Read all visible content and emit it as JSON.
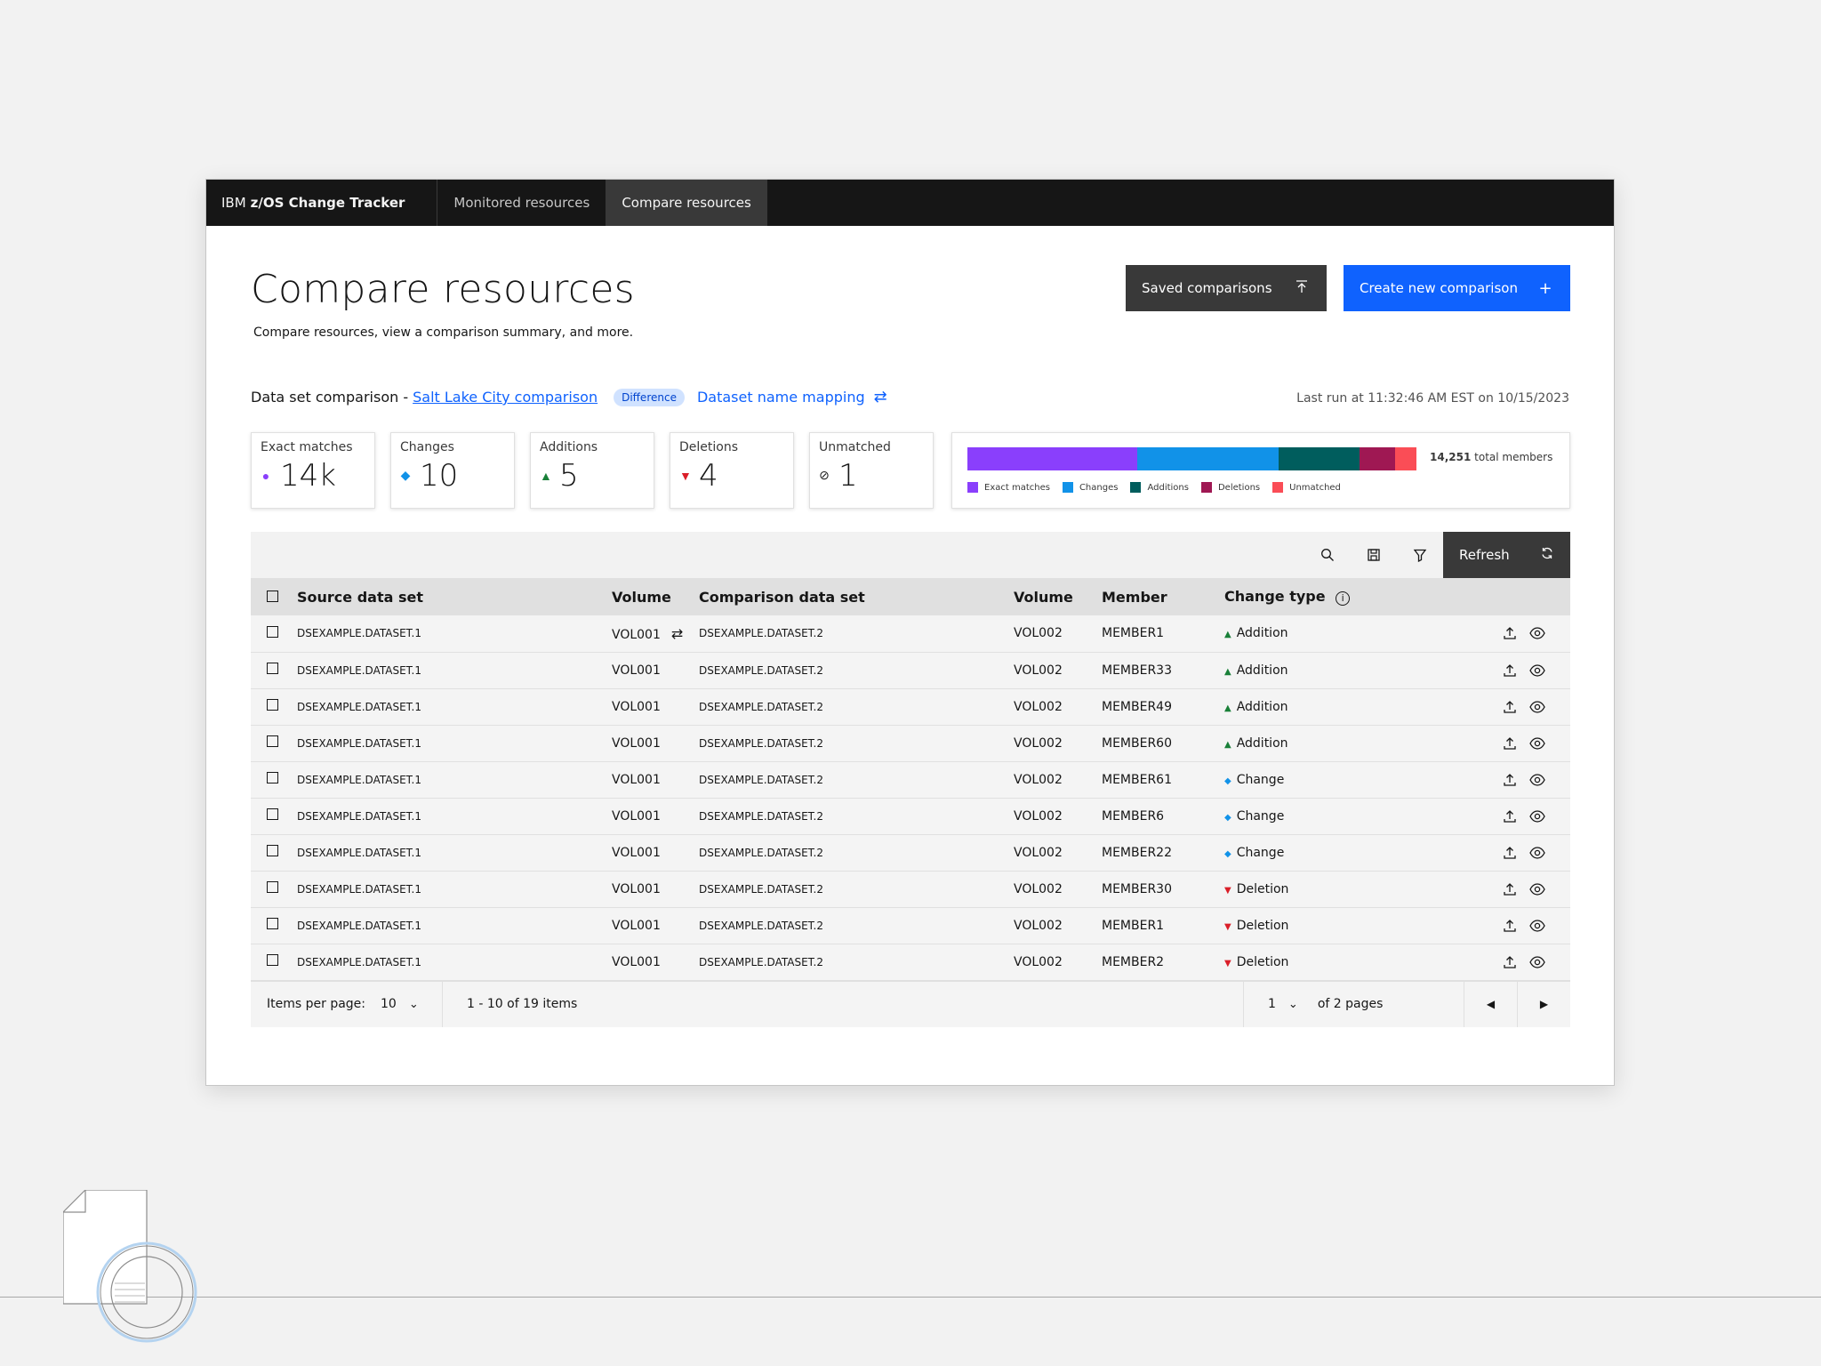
{
  "topbar": {
    "brand_prefix": "IBM",
    "brand_name": "z/OS Change Tracker",
    "tabs": [
      {
        "label": "Monitored resources"
      },
      {
        "label": "Compare resources"
      }
    ]
  },
  "page": {
    "title": "Compare resources",
    "subtitle": "Compare resources, view a comparison summary, and more."
  },
  "buttons": {
    "saved_label": "Saved comparisons",
    "saved_icon": "upload-icon",
    "create_label": "Create new comparison",
    "create_icon": "add-icon"
  },
  "context": {
    "prefix": "Data set comparison -",
    "comparison_link": "Salt Lake City comparison",
    "tag": "Difference",
    "mapping_link": "Dataset name mapping",
    "last_run": "Last run at 11:32:46 AM EST on 10/15/2023"
  },
  "cards": [
    {
      "label": "Exact matches",
      "value": "14k",
      "marker": "●",
      "color": "#8a3ffc"
    },
    {
      "label": "Changes",
      "value": "10",
      "marker": "◆",
      "color": "#1192e8"
    },
    {
      "label": "Additions",
      "value": "5",
      "marker": "▲",
      "color": "#198038"
    },
    {
      "label": "Deletions",
      "value": "4",
      "marker": "▼",
      "color": "#da1e28"
    },
    {
      "label": "Unmatched",
      "value": "1",
      "marker": "⊘",
      "color": "#161616"
    }
  ],
  "summary": {
    "total_value": "14,251",
    "total_suffix": "total members",
    "segments": [
      {
        "label": "Exact matches",
        "color": "#8a3ffc",
        "share": 0.378
      },
      {
        "label": "Changes",
        "color": "#1192e8",
        "share": 0.315
      },
      {
        "label": "Additions",
        "color": "#005d5d",
        "share": 0.18
      },
      {
        "label": "Deletions",
        "color": "#9f1853",
        "share": 0.08
      },
      {
        "label": "Unmatched",
        "color": "#fa4d56",
        "share": 0.047
      }
    ]
  },
  "toolbar": {
    "refresh_label": "Refresh"
  },
  "table": {
    "headers": [
      "Source data set",
      "Volume",
      "Comparison data set",
      "Volume",
      "Member",
      "Change type"
    ],
    "rows": [
      {
        "src": "DSEXAMPLE.DATASET.1",
        "vol1": "VOL001",
        "cmp": "DSEXAMPLE.DATASET.2",
        "vol2": "VOL002",
        "member": "MEMBER1",
        "type": "Addition"
      },
      {
        "src": "DSEXAMPLE.DATASET.1",
        "vol1": "VOL001",
        "cmp": "DSEXAMPLE.DATASET.2",
        "vol2": "VOL002",
        "member": "MEMBER33",
        "type": "Addition"
      },
      {
        "src": "DSEXAMPLE.DATASET.1",
        "vol1": "VOL001",
        "cmp": "DSEXAMPLE.DATASET.2",
        "vol2": "VOL002",
        "member": "MEMBER49",
        "type": "Addition"
      },
      {
        "src": "DSEXAMPLE.DATASET.1",
        "vol1": "VOL001",
        "cmp": "DSEXAMPLE.DATASET.2",
        "vol2": "VOL002",
        "member": "MEMBER60",
        "type": "Addition"
      },
      {
        "src": "DSEXAMPLE.DATASET.1",
        "vol1": "VOL001",
        "cmp": "DSEXAMPLE.DATASET.2",
        "vol2": "VOL002",
        "member": "MEMBER61",
        "type": "Change"
      },
      {
        "src": "DSEXAMPLE.DATASET.1",
        "vol1": "VOL001",
        "cmp": "DSEXAMPLE.DATASET.2",
        "vol2": "VOL002",
        "member": "MEMBER6",
        "type": "Change"
      },
      {
        "src": "DSEXAMPLE.DATASET.1",
        "vol1": "VOL001",
        "cmp": "DSEXAMPLE.DATASET.2",
        "vol2": "VOL002",
        "member": "MEMBER22",
        "type": "Change"
      },
      {
        "src": "DSEXAMPLE.DATASET.1",
        "vol1": "VOL001",
        "cmp": "DSEXAMPLE.DATASET.2",
        "vol2": "VOL002",
        "member": "MEMBER30",
        "type": "Deletion"
      },
      {
        "src": "DSEXAMPLE.DATASET.1",
        "vol1": "VOL001",
        "cmp": "DSEXAMPLE.DATASET.2",
        "vol2": "VOL002",
        "member": "MEMBER1",
        "type": "Deletion"
      },
      {
        "src": "DSEXAMPLE.DATASET.1",
        "vol1": "VOL001",
        "cmp": "DSEXAMPLE.DATASET.2",
        "vol2": "VOL002",
        "member": "MEMBER2",
        "type": "Deletion"
      }
    ]
  },
  "change_markers": {
    "Addition": {
      "glyph": "▲",
      "color": "#198038"
    },
    "Change": {
      "glyph": "◆",
      "color": "#1192e8"
    },
    "Deletion": {
      "glyph": "▼",
      "color": "#da1e28"
    }
  },
  "pagination": {
    "items_per_page_label": "Items per page:",
    "items_per_page": "10",
    "range": "1 - 10 of 19 items",
    "current_page": "1",
    "pages_label": "of 2 pages"
  }
}
